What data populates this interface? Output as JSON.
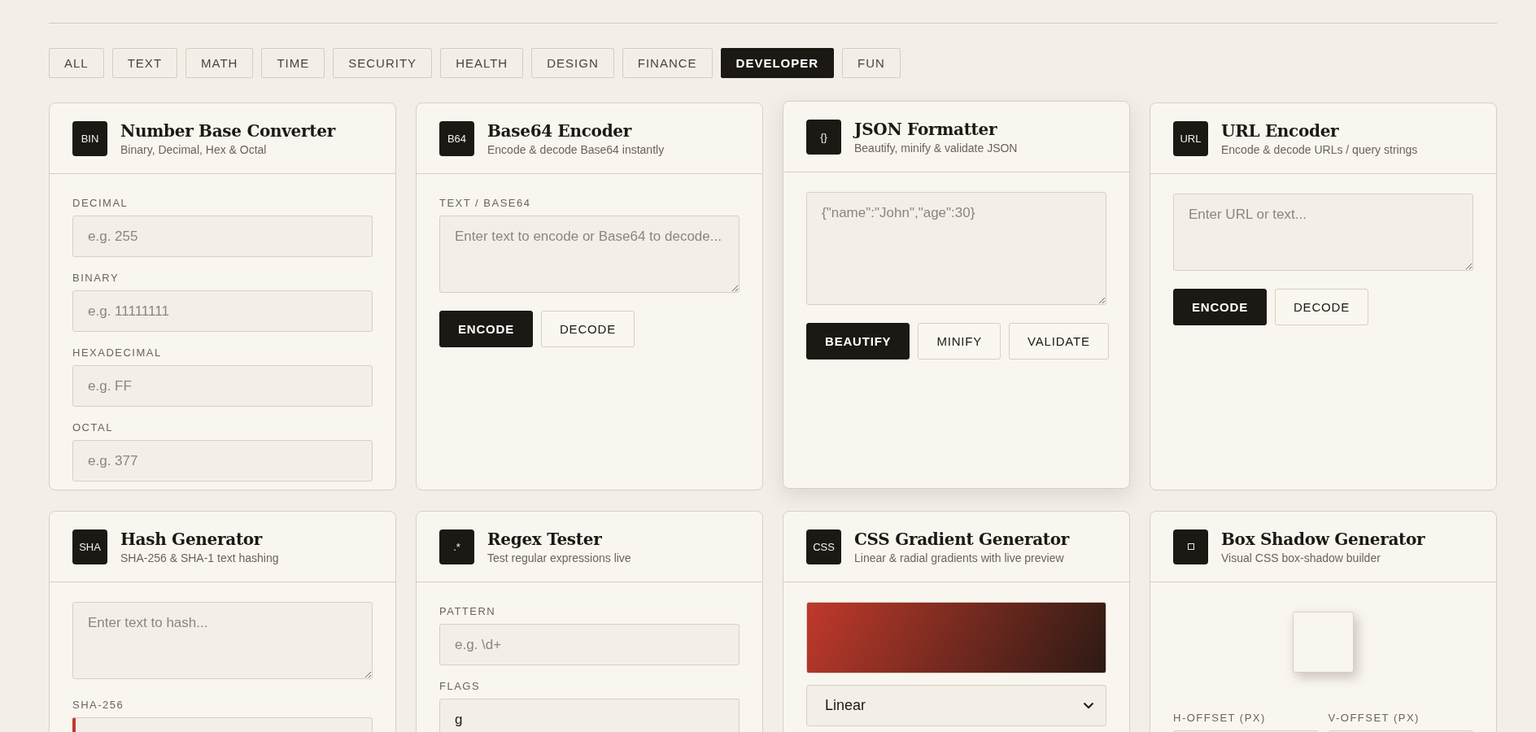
{
  "tabs": [
    {
      "label": "ALL",
      "selected": false
    },
    {
      "label": "TEXT",
      "selected": false
    },
    {
      "label": "MATH",
      "selected": false
    },
    {
      "label": "TIME",
      "selected": false
    },
    {
      "label": "SECURITY",
      "selected": false
    },
    {
      "label": "HEALTH",
      "selected": false
    },
    {
      "label": "DESIGN",
      "selected": false
    },
    {
      "label": "FINANCE",
      "selected": false
    },
    {
      "label": "DEVELOPER",
      "selected": true
    },
    {
      "label": "FUN",
      "selected": false
    }
  ],
  "cards": [
    {
      "badge": "BIN",
      "title": "Number Base Converter",
      "subtitle": "Binary, Decimal, Hex & Octal",
      "hovered": false,
      "body": [
        {
          "kind": "field",
          "label": "DECIMAL",
          "placeholder": "e.g. 255"
        },
        {
          "kind": "field",
          "label": "BINARY",
          "placeholder": "e.g. 11111111"
        },
        {
          "kind": "field",
          "label": "HEXADECIMAL",
          "placeholder": "e.g. FF"
        },
        {
          "kind": "field",
          "label": "OCTAL",
          "placeholder": "e.g. 377"
        }
      ]
    },
    {
      "badge": "B64",
      "title": "Base64 Encoder",
      "subtitle": "Encode & decode Base64 instantly",
      "hovered": false,
      "body": [
        {
          "kind": "textarea",
          "label": "TEXT / BASE64",
          "placeholder": "Enter text to encode or Base64 to decode..."
        },
        {
          "kind": "buttons",
          "buttons": [
            {
              "label": "ENCODE",
              "primary": true
            },
            {
              "label": "DECODE",
              "primary": false
            }
          ]
        }
      ]
    },
    {
      "badge": "{}",
      "title": "JSON Formatter",
      "subtitle": "Beautify, minify & validate JSON",
      "hovered": true,
      "body": [
        {
          "kind": "code_area",
          "placeholder": "{\"name\":\"John\",\"age\":30}"
        },
        {
          "kind": "buttons",
          "buttons": [
            {
              "label": "BEAUTIFY",
              "primary": true
            },
            {
              "label": "MINIFY",
              "primary": false
            },
            {
              "label": "VALIDATE",
              "primary": false
            }
          ]
        }
      ]
    },
    {
      "badge": "URL",
      "title": "URL Encoder",
      "subtitle": "Encode & decode URLs / query strings",
      "hovered": false,
      "body": [
        {
          "kind": "textarea",
          "placeholder": "Enter URL or text..."
        },
        {
          "kind": "buttons",
          "buttons": [
            {
              "label": "ENCODE",
              "primary": true
            },
            {
              "label": "DECODE",
              "primary": false
            }
          ]
        }
      ]
    },
    {
      "badge": "SHA",
      "title": "Hash Generator",
      "subtitle": "SHA-256 & SHA-1 text hashing",
      "hovered": false,
      "body": [
        {
          "kind": "textarea",
          "placeholder": "Enter text to hash..."
        },
        {
          "kind": "output",
          "label": "SHA-256"
        }
      ]
    },
    {
      "badge": ".*",
      "title": "Regex Tester",
      "subtitle": "Test regular expressions live",
      "hovered": false,
      "body": [
        {
          "kind": "field",
          "label": "PATTERN",
          "placeholder": "e.g. \\d+"
        },
        {
          "kind": "field",
          "label": "FLAGS",
          "value": "g"
        }
      ]
    },
    {
      "badge": "CSS",
      "title": "CSS Gradient Generator",
      "subtitle": "Linear & radial gradients with live preview",
      "hovered": false,
      "body": [
        {
          "kind": "gradient"
        },
        {
          "kind": "select",
          "value": "Linear"
        }
      ]
    },
    {
      "title": "Box Shadow Generator",
      "subtitle": "Visual CSS box-shadow builder",
      "hovered": false,
      "body": [
        {
          "kind": "shadow_preview"
        },
        {
          "kind": "field_pair",
          "fields": [
            {
              "label": "H-OFFSET (PX)"
            },
            {
              "label": "V-OFFSET (PX)"
            }
          ]
        }
      ]
    }
  ]
}
